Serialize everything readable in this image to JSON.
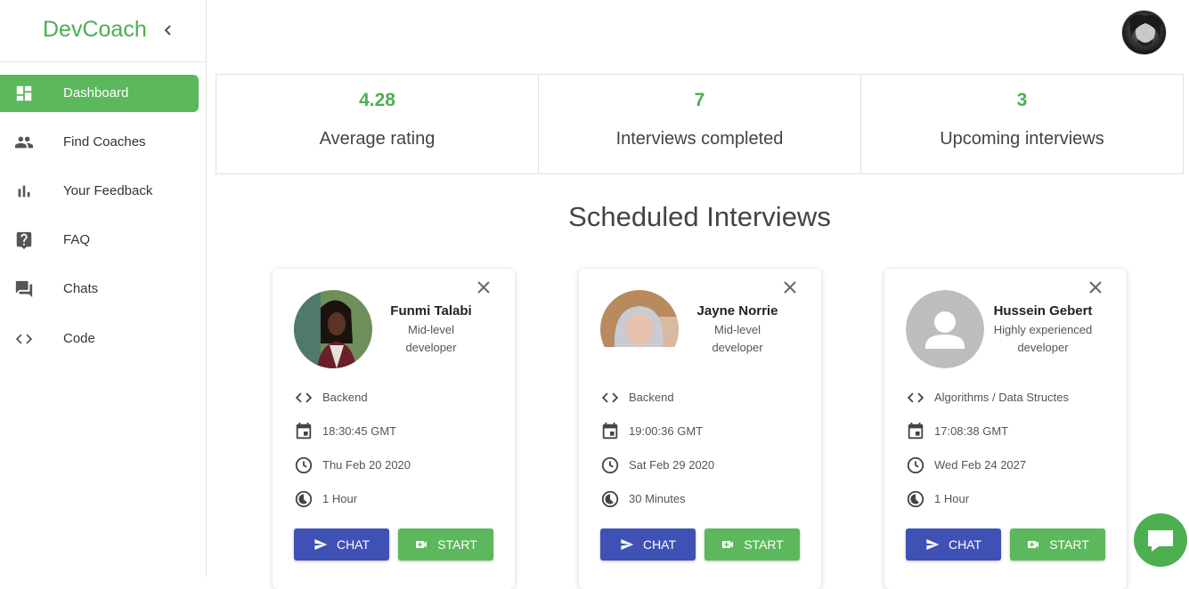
{
  "brand": {
    "title": "DevCoach"
  },
  "nav": [
    {
      "label": "Dashboard",
      "icon": "dashboard-icon",
      "active": true
    },
    {
      "label": "Find Coaches",
      "icon": "people-icon"
    },
    {
      "label": "Your Feedback",
      "icon": "bar-chart-icon"
    },
    {
      "label": "FAQ",
      "icon": "help-icon"
    },
    {
      "label": "Chats",
      "icon": "chat-bubbles-icon"
    },
    {
      "label": "Code",
      "icon": "code-icon"
    }
  ],
  "stats": [
    {
      "value": "4.28",
      "caption": "Average rating"
    },
    {
      "value": "7",
      "caption": "Interviews completed"
    },
    {
      "value": "3",
      "caption": "Upcoming interviews"
    }
  ],
  "scheduled_title": "Scheduled Interviews",
  "cards": [
    {
      "name": "Funmi Talabi",
      "role_line1": "Mid-level",
      "role_line2": "developer",
      "topic": "Backend",
      "time": "18:30:45 GMT",
      "date": "Thu Feb 20 2020",
      "duration": "1 Hour",
      "chat_label": "CHAT",
      "start_label": "START"
    },
    {
      "name": "Jayne Norrie",
      "role_line1": "Mid-level",
      "role_line2": "developer",
      "topic": "Backend",
      "time": "19:00:36 GMT",
      "date": "Sat Feb 29 2020",
      "duration": "30 Minutes",
      "chat_label": "CHAT",
      "start_label": "START"
    },
    {
      "name": "Hussein Gebert",
      "role_line1": "Highly experienced",
      "role_line2": "developer",
      "topic": "Algorithms / Data Structes",
      "time": "17:08:38 GMT",
      "date": "Wed Feb 24 2027",
      "duration": "1 Hour",
      "chat_label": "CHAT",
      "start_label": "START"
    }
  ],
  "colors": {
    "accent": "#4caf50",
    "primary": "#3f51b5",
    "nav_active": "#5cb85c"
  }
}
